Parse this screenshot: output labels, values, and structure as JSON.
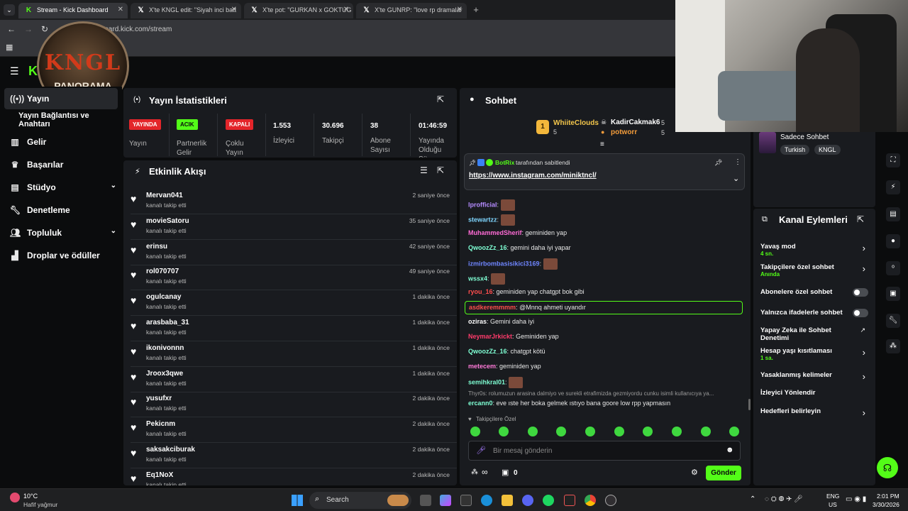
{
  "browser": {
    "tabs": [
      {
        "label": "Stream - Kick Dashboard",
        "icon": "kick-logo-icon",
        "active": true
      },
      {
        "label": "X'te KNGL edit: \"Siyah inci batt",
        "icon": "x-logo-icon",
        "active": false
      },
      {
        "label": "X'te pot: \"GURKAN x GOKTUG",
        "icon": "x-logo-icon",
        "active": false
      },
      {
        "label": "X'te GUNRP: \"love rp dramalar",
        "icon": "x-logo-icon",
        "active": false
      }
    ],
    "url": "dashboard.kick.com/stream"
  },
  "overlay": {
    "logo_title": "KNGL",
    "logo_subtitle": "PANORAMA"
  },
  "sidebar": {
    "items": [
      {
        "label": "Yayın",
        "icon": "broadcast-icon"
      },
      {
        "label": "Yayın Bağlantısı ve Anahtarı",
        "icon": ""
      },
      {
        "label": "Gelir",
        "icon": "chart-icon"
      },
      {
        "label": "Başarılar",
        "icon": "trophy-icon"
      },
      {
        "label": "Stüdyo",
        "icon": "studio-icon"
      },
      {
        "label": "Denetleme",
        "icon": "wrench-icon"
      },
      {
        "label": "Topluluk",
        "icon": "users-icon"
      },
      {
        "label": "Droplar ve ödüller",
        "icon": "gift-icon"
      }
    ]
  },
  "stats": {
    "title": "Yayın İstatistikleri",
    "columns": [
      {
        "badge": "YAYINDA",
        "label": "Yayın"
      },
      {
        "badge": "ACIK",
        "label": "Partnerlik Gelir"
      },
      {
        "badge": "KAPALI",
        "label": "Çoklu Yayın"
      },
      {
        "value": "1.553",
        "label": "İzleyici"
      },
      {
        "value": "30.696",
        "label": "Takipçi"
      },
      {
        "value": "38",
        "label": "Abone Sayısı"
      },
      {
        "value": "01:46:59",
        "label": "Yayında Olduğu Sü"
      }
    ]
  },
  "activity": {
    "title": "Etkinlik Akışı",
    "events": [
      {
        "name": "Mervan041",
        "action": "kanalı takip etti",
        "time": "2 saniye önce"
      },
      {
        "name": "movieSatoru",
        "action": "kanalı takip etti",
        "time": "35 saniye önce"
      },
      {
        "name": "erinsu",
        "action": "kanalı takip etti",
        "time": "42 saniye önce"
      },
      {
        "name": "rol070707",
        "action": "kanalı takip etti",
        "time": "49 saniye önce"
      },
      {
        "name": "ogulcanay",
        "action": "kanalı takip etti",
        "time": "1 dakika önce"
      },
      {
        "name": "arasbaba_31",
        "action": "kanalı takip etti",
        "time": "1 dakika önce"
      },
      {
        "name": "ikonivonnn",
        "action": "kanalı takip etti",
        "time": "1 dakika önce"
      },
      {
        "name": "Jroox3qwe",
        "action": "kanalı takip etti",
        "time": "1 dakika önce"
      },
      {
        "name": "yusufxr",
        "action": "kanalı takip etti",
        "time": "2 dakika önce"
      },
      {
        "name": "Pekicnm",
        "action": "kanalı takip etti",
        "time": "2 dakika önce"
      },
      {
        "name": "saksakciburak",
        "action": "kanalı takip etti",
        "time": "2 dakika önce"
      },
      {
        "name": "Eq1NoX",
        "action": "kanalı takip etti",
        "time": "2 dakika önce"
      }
    ]
  },
  "chat": {
    "title": "Sohbet",
    "top_supporters": [
      {
        "rank": "1",
        "name": "WhiiteClouds",
        "count": "5"
      },
      {
        "name": "KadirCakmak6",
        "count": "5"
      },
      {
        "name": "potworr",
        "count": "5"
      }
    ],
    "pinned": {
      "by_user": "BotRix",
      "by_suffix": "tarafından sabitlendi",
      "link": "https://www.instagram.com/miniktncl/"
    },
    "messages": [
      {
        "user": "lprofficial",
        "color": "#b58cff",
        "text": "",
        "emote": true
      },
      {
        "user": "stewartzz",
        "color": "#7fd6ff",
        "text": "",
        "emote": true
      },
      {
        "user": "MuhammedSherif",
        "color": "#ff6bd6",
        "text": "geminiden yap",
        "emote": false
      },
      {
        "user": "QwoozZz_16",
        "color": "#7fffd4",
        "text": "gemini daha iyi yapar",
        "emote": false
      },
      {
        "user": "izmirbombasisikici3169",
        "color": "#6f86ff",
        "text": "",
        "emote": true
      },
      {
        "user": "wssx4",
        "color": "#7fffd4",
        "text": "",
        "emote": true
      },
      {
        "user": "ryou_16",
        "color": "#ff4d4d",
        "text": "geminiden yap chatgpt bok gibi",
        "emote": false
      },
      {
        "user": "asdkeremmmm",
        "color": "#ff4d4d",
        "text": "@Mnnq ahmeti uyandır",
        "emote": false,
        "highlight": true
      },
      {
        "user": "oziras",
        "color": "#ffffff",
        "text": "Gemini daha iyi",
        "emote": false
      },
      {
        "user": "NeymarJrkickt",
        "color": "#ff3b6b",
        "text": "Geminiden yap",
        "emote": false
      },
      {
        "user": "QwoozZz_16",
        "color": "#7fffd4",
        "text": "chatgpt kötü",
        "emote": false
      },
      {
        "user": "metecem",
        "color": "#ff7ad9",
        "text": "geminiden yap",
        "emote": false
      },
      {
        "user": "semihkral01",
        "color": "#7fffd4",
        "text": "",
        "emote": true
      }
    ],
    "reply_preview": "Thyr0s: rolumuzun arasina dalmiyo ve surekli etrafimizda gezmiyordu cunku isimli kullanıcıya ya...",
    "last_message": {
      "user": "ercann0",
      "text": "eve ıste her boka gelmek ıstıyo bana goore low rpp yapmasın"
    },
    "mode_label": "Takipçilere Özel",
    "input_placeholder": "Bir mesaj gönderin",
    "points": "0",
    "send_label": "Gönder"
  },
  "right": {
    "sohbet_info": "Sadece Sohbet",
    "tags": [
      "Turkish",
      "KNGL"
    ],
    "actions_title": "Kanal Eylemleri",
    "actions": [
      {
        "label": "Yavaş mod",
        "value": "4 sn.",
        "control": "chevron"
      },
      {
        "label": "Takipçilere özel sohbet",
        "value": "Anında",
        "control": "chevron"
      },
      {
        "label": "Abonelere özel sohbet",
        "value": "",
        "control": "toggle"
      },
      {
        "label": "Yalnızca ifadelerle sohbet",
        "value": "",
        "control": "toggle"
      },
      {
        "label": "Yapay Zeka ile Sohbet Denetimi",
        "value": "",
        "control": "external"
      },
      {
        "label": "Hesap yaşı kısıtlaması",
        "value": "1 sa.",
        "control": "chevron"
      },
      {
        "label": "Yasaklanmış kelimeler",
        "value": "",
        "control": "chevron"
      },
      {
        "label": "İzleyici Yönlendir",
        "value": "",
        "control": "none"
      },
      {
        "label": "Hedefleri belirleyin",
        "value": "",
        "control": "chevron"
      }
    ]
  },
  "taskbar": {
    "weather_temp": "10°C",
    "weather_desc": "Hafif yağmur",
    "search_label": "Search",
    "lang": "ENG",
    "region": "US",
    "time": "2:01 PM",
    "date": "3/30/2026"
  }
}
